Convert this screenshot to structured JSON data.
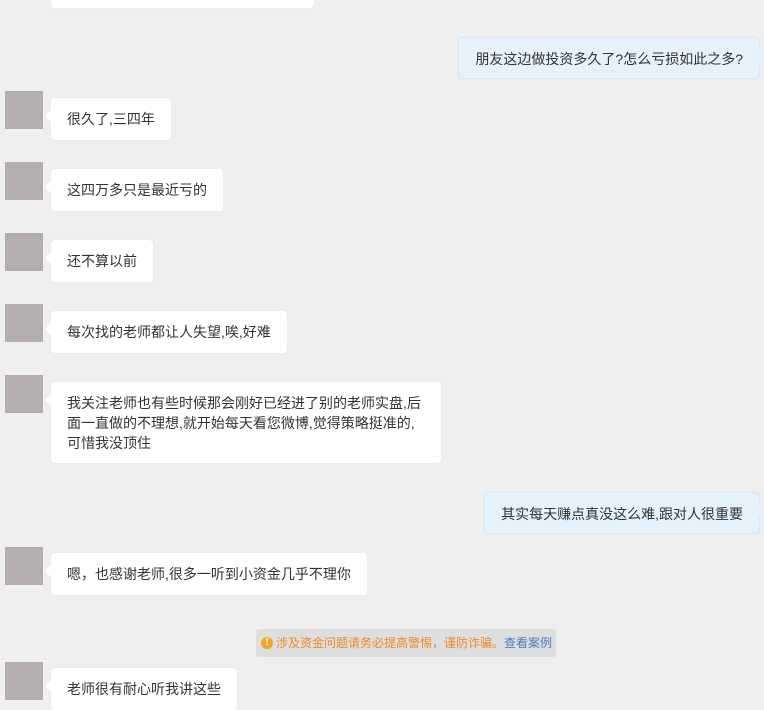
{
  "messages": [
    {
      "id": "m0",
      "side": "left",
      "text": ""
    },
    {
      "id": "m1",
      "side": "right",
      "text": "朋友这边做投资多久了?怎么亏损如此之多?"
    },
    {
      "id": "m2",
      "side": "left",
      "text": "很久了,三四年"
    },
    {
      "id": "m3",
      "side": "left",
      "text": "这四万多只是最近亏的"
    },
    {
      "id": "m4",
      "side": "left",
      "text": "还不算以前"
    },
    {
      "id": "m5",
      "side": "left",
      "text": "每次找的老师都让人失望,唉,好难"
    },
    {
      "id": "m6",
      "side": "left",
      "text": "我关注老师也有些时候那会刚好已经进了别的老师实盘,后面一直做的不理想,就开始每天看您微博,觉得策略挺准的,可惜我没顶住"
    },
    {
      "id": "m7",
      "side": "right",
      "text": "其实每天赚点真没这么难,跟对人很重要"
    },
    {
      "id": "m8",
      "side": "left",
      "text": "嗯，也感谢老师,很多一听到小资金几乎不理你"
    },
    {
      "id": "m9",
      "side": "left",
      "text": "老师很有耐心听我讲这些"
    }
  ],
  "notice": {
    "icon": "exclamation-circle-icon",
    "text": "涉及资金问题请务必提高警惕，谨防诈骗。",
    "link": "查看案例"
  },
  "colors": {
    "background": "#efefef",
    "left_bubble": "#ffffff",
    "right_bubble": "#e5f1fb",
    "avatar": "#b3adad",
    "notice_text": "#f08a24",
    "notice_link": "#4a7cc2"
  }
}
